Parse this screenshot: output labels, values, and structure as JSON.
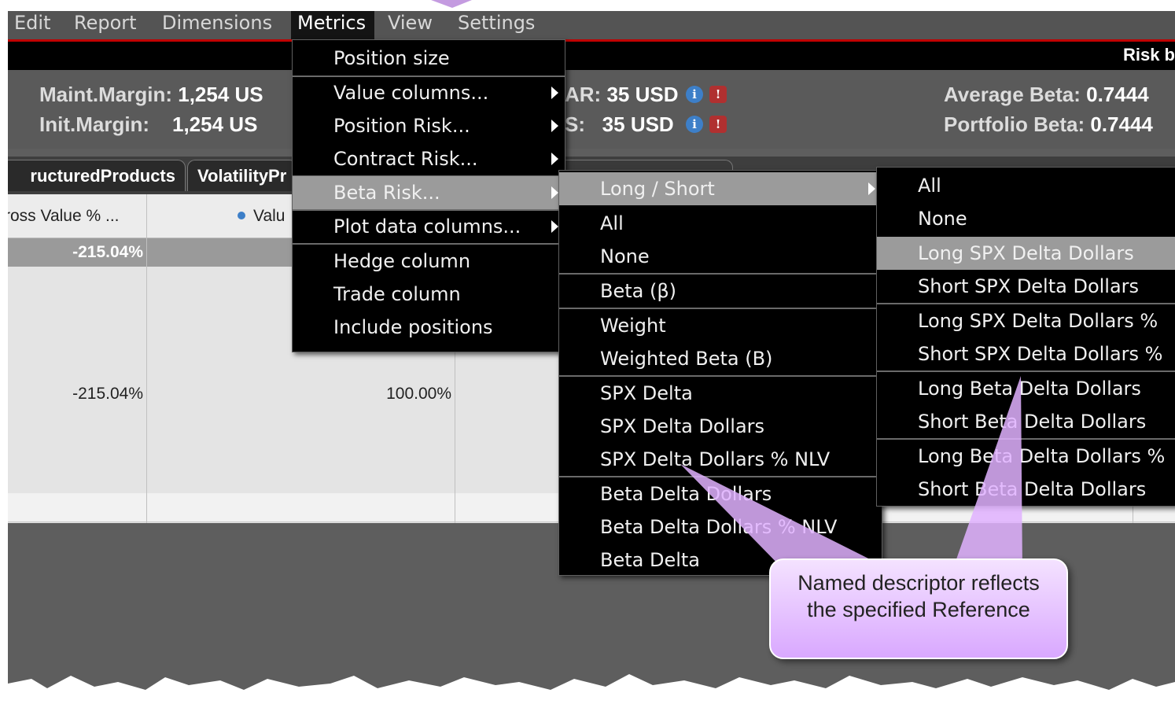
{
  "menubar": {
    "items": [
      "Edit",
      "Report",
      "Dimensions",
      "Metrics",
      "View",
      "Settings"
    ],
    "active": "Metrics"
  },
  "title_strip": {
    "text": "Risk b"
  },
  "summary": {
    "maint_label": "Maint.Margin:",
    "maint_value": "1,254 US",
    "init_label": "Init.Margin:",
    "init_value": "1,254 US",
    "var1_label": "AR:",
    "var1_value": "35 USD",
    "var2_label": "S:",
    "var2_value": "35 USD",
    "avg_beta_label": "Average Beta:",
    "avg_beta_value": "0.7444",
    "port_beta_label": "Portfolio Beta:",
    "port_beta_value": "0.7444"
  },
  "tabs": [
    "ructuredProducts",
    "VolatilityPr"
  ],
  "grid": {
    "col1_header": "ross Value % ...",
    "col2_header": "Valu",
    "rows": [
      {
        "c1": "-215.04%",
        "c2": ""
      },
      {
        "c1": "",
        "c2": ""
      },
      {
        "c1": "",
        "c2": ""
      },
      {
        "c1": "",
        "c2": ""
      },
      {
        "c1": "",
        "c2": ""
      },
      {
        "c1": "-215.04%",
        "c2": "100.00%"
      },
      {
        "c1": "",
        "c2": ""
      },
      {
        "c1": "",
        "c2": ""
      },
      {
        "c1": "",
        "c2": ""
      },
      {
        "c1": "",
        "c2": ""
      }
    ]
  },
  "metrics_menu": {
    "items": [
      "Position size",
      "Value columns...",
      "Position Risk...",
      "Contract Risk...",
      "Beta Risk...",
      "Plot data columns...",
      "Hedge column",
      "Trade column",
      "Include positions"
    ]
  },
  "beta_menu": {
    "items": [
      "Long / Short",
      "All",
      "None",
      "Beta (β)",
      "Weight",
      "Weighted Beta (B)",
      "SPX Delta",
      "SPX Delta Dollars",
      "SPX Delta Dollars % NLV",
      "Beta Delta Dollars",
      "Beta Delta Dollars % NLV",
      "Beta Delta"
    ]
  },
  "longshort_menu": {
    "items": [
      "All",
      "None",
      "Long SPX Delta Dollars",
      "Short SPX Delta Dollars",
      "Long SPX Delta Dollars %",
      "Short SPX Delta Dollars %",
      "Long Beta Delta Dollars",
      "Short Beta Delta Dollars",
      "Long Beta Delta Dollars %",
      "Short Beta Delta Dollars"
    ]
  },
  "callout": {
    "line1": "Named descriptor reflects",
    "line2": "the specified Reference"
  },
  "colors": {
    "highlight": "#9b9b9b",
    "menu_bg": "#000000",
    "accent_red": "#c00000",
    "callout": "#d9a8ff"
  }
}
